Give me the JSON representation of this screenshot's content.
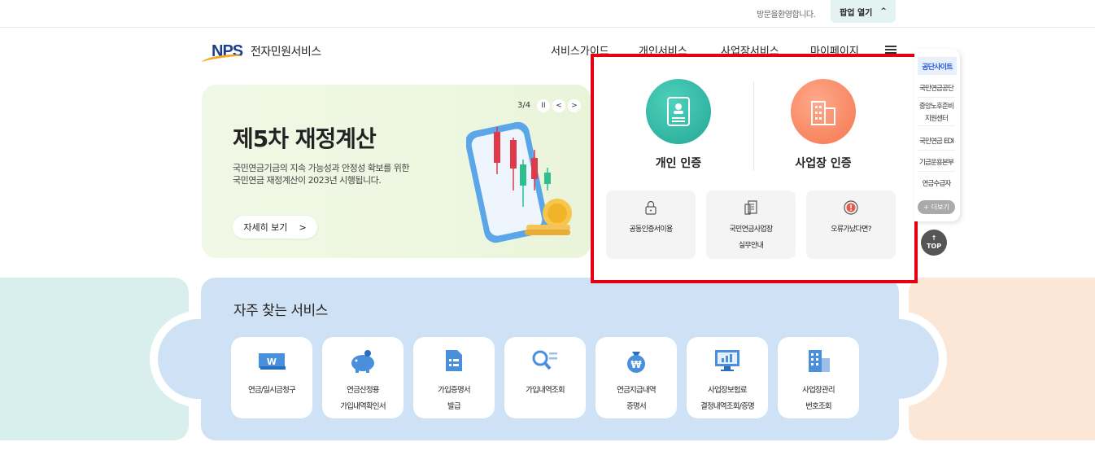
{
  "topbar": {
    "visitor_text": "방문을환영합니다.",
    "popup_label": "팝업 열기",
    "popup_chevron": "^"
  },
  "header": {
    "logo_brand": "NPS",
    "logo_text": "전자민원서비스",
    "nav": [
      "서비스가이드",
      "개인서비스",
      "사업장서비스",
      "마이페이지"
    ]
  },
  "banner": {
    "counter": "3/4",
    "pause": "II",
    "prev": "<",
    "next": ">",
    "title": "제5차 재정계산",
    "desc_line1": "국민연금기금의 지속 가능성과 안정성 확보를 위한",
    "desc_line2": "국민연금 재정계산이 2023년 시행됩니다.",
    "more_label": "자세히 보기",
    "more_arrow": ">"
  },
  "auth": {
    "personal_label": "개인 인증",
    "business_label": "사업장 인증",
    "cards": [
      {
        "label1": "공동인증서이용",
        "label2": "",
        "icon": "lock-icon"
      },
      {
        "label1": "국민연금사업장",
        "label2": "실무안내",
        "icon": "document-icon"
      },
      {
        "label1": "오류가났다면?",
        "label2": "",
        "icon": "alert-icon"
      }
    ]
  },
  "quick_menu": {
    "head": "공단사이트",
    "items": [
      "국민연금공단",
      "중앙노후준비",
      "지원센터",
      "국민연금 EDI",
      "기금운용본부",
      "연금수급자"
    ],
    "more": "더보기",
    "top": "TOP"
  },
  "services": {
    "title": "자주 찾는 서비스",
    "items": [
      {
        "line1": "연금/일시금청구",
        "line2": "",
        "icon": "won-card-icon"
      },
      {
        "line1": "연금산정용",
        "line2": "가입내역확인서",
        "icon": "piggy-bank-icon"
      },
      {
        "line1": "가입증명서",
        "line2": "발급",
        "icon": "document-list-icon"
      },
      {
        "line1": "가입내역조회",
        "line2": "",
        "icon": "search-list-icon"
      },
      {
        "line1": "연금지급내역",
        "line2": "증명서",
        "icon": "money-bag-icon"
      },
      {
        "line1": "사업장보험료",
        "line2": "결정내역조회/증명",
        "icon": "monitor-chart-icon"
      },
      {
        "line1": "사업장관리",
        "line2": "번호조회",
        "icon": "building-icon"
      }
    ]
  },
  "colors": {
    "accent_red": "#e60012",
    "teal": "#23a895",
    "orange": "#f3774f",
    "service_bg": "#cfe1f4"
  }
}
